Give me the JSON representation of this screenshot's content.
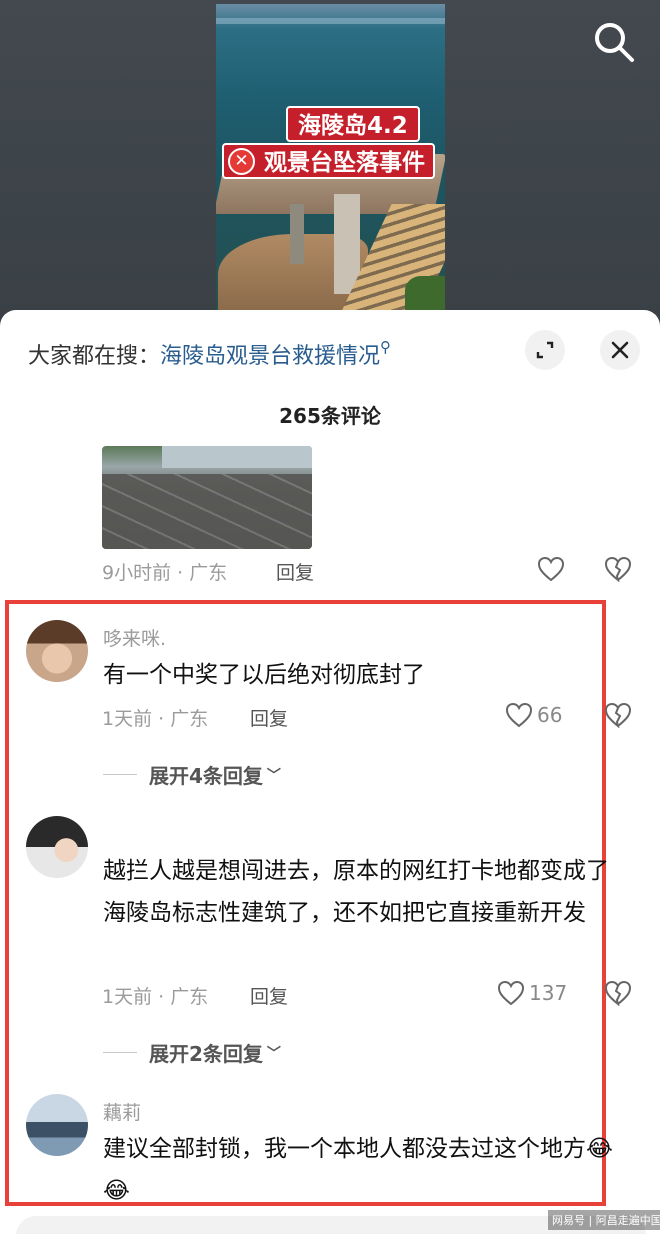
{
  "video": {
    "tag_line1": "海陵岛4.2",
    "tag_line2": "观景台坠落事件",
    "cross_icon": "cross-circle-icon",
    "search_icon": "search-icon"
  },
  "sheet": {
    "hot_prefix": "大家都在搜：",
    "hot_link": "海陵岛观景台救援情况",
    "comment_count": "265条评论",
    "expand_icon": "expand-icon",
    "close_icon": "close-icon"
  },
  "first": {
    "meta": "9小时前 · 广东",
    "reply": "回复"
  },
  "comments": [
    {
      "name": "哆来咪.",
      "text": "有一个中奖了以后绝对彻底封了",
      "meta": "1天前 · 广东",
      "reply": "回复",
      "likes": "66",
      "more": "展开4条回复"
    },
    {
      "name": "",
      "text": "越拦人越是想闯进去，原本的网红打卡地都变成了海陵岛标志性建筑了，还不如把它直接重新开发",
      "meta": "1天前 · 广东",
      "reply": "回复",
      "likes": "137",
      "more": "展开2条回复"
    },
    {
      "name": "藕莉",
      "text": "建议全部封锁，我一个本地人都没去过这个地方😂😂"
    }
  ],
  "watermark": "网易号 | 阿昌走遍中国",
  "colors": {
    "highlight_box": "#e8413a",
    "link": "#2a5d8f",
    "tag_red": "#c41f2a"
  }
}
